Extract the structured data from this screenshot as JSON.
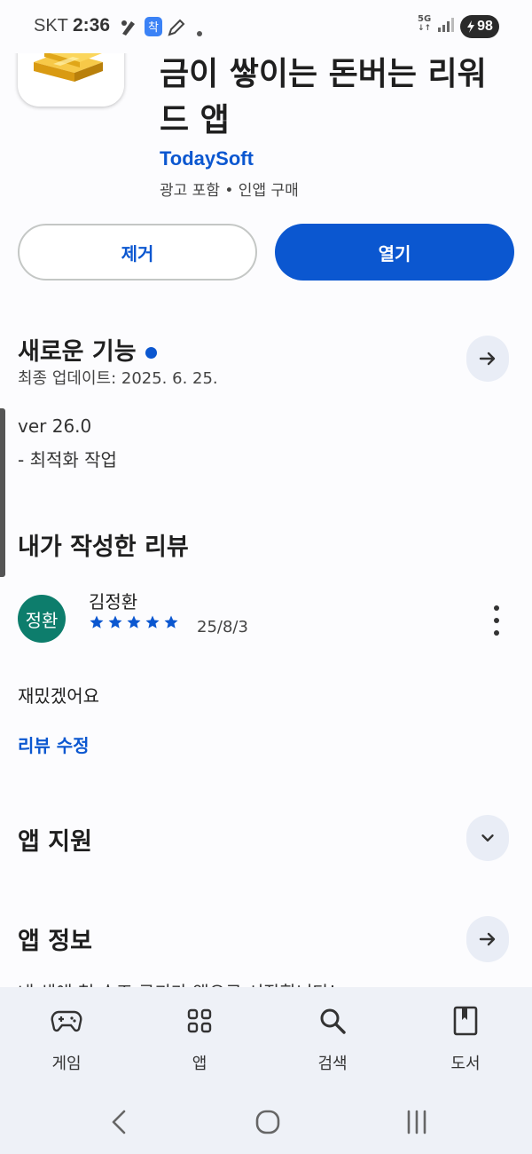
{
  "status_bar": {
    "carrier": "SKT",
    "time": "2:36",
    "network": "5G",
    "battery": "98"
  },
  "app": {
    "title": "금이 쌓이는 돈버는 리워드 앱",
    "developer": "TodaySoft",
    "meta": "광고 포함 • 인앱 구매",
    "icon": "gold-bars-icon"
  },
  "buttons": {
    "remove": "제거",
    "open": "열기"
  },
  "whats_new": {
    "title": "새로운 기능",
    "last_update": "최종 업데이트: 2025. 6. 25.",
    "version": "ver 26.0",
    "notes": "- 최적화 작업"
  },
  "my_review": {
    "title": "내가 작성한 리뷰",
    "avatar_text": "정환",
    "name": "김정환",
    "rating": 5,
    "date": "25/8/3",
    "body": "재밌겠어요",
    "edit_link": "리뷰 수정"
  },
  "app_support": {
    "title": "앱 지원"
  },
  "app_info": {
    "title": "앱 정보",
    "clipped_text": "내 생애 첫 수조 금괴가 앱으로 시작합니다!"
  },
  "bottom_nav": {
    "items": [
      {
        "label": "게임",
        "icon": "gamepad-icon"
      },
      {
        "label": "앱",
        "icon": "apps-grid-icon"
      },
      {
        "label": "검색",
        "icon": "search-icon"
      },
      {
        "label": "도서",
        "icon": "book-icon"
      }
    ]
  },
  "colors": {
    "accent": "#0b57d0",
    "avatar": "#0d7d6c",
    "nav_bg": "#eef1f7"
  }
}
